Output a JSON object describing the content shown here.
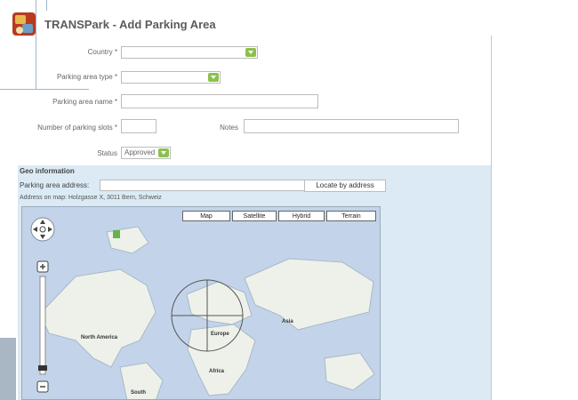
{
  "app": {
    "title": "TRANSPark - Add Parking Area"
  },
  "form": {
    "country_label": "Country *",
    "parking_type_label": "Parking area type *",
    "parking_name_label": "Parking area name *",
    "parking_slots_label": "Number of parking slots *",
    "notes_label": "Notes",
    "status_label": "Status",
    "status_value": "Approved"
  },
  "geo": {
    "title": "Geo information",
    "address_label": "Parking area address:",
    "locate_button": "Locate by address",
    "address_on_map": "Address on map: Holzgasse X, 3011 Bern, Schweiz"
  },
  "map": {
    "types": [
      "Map",
      "Satellite",
      "Hybrid",
      "Terrain"
    ],
    "labels": [
      "North America",
      "Europe",
      "Asia",
      "Africa",
      "South"
    ]
  },
  "colors": {
    "accent": "#8cc04f",
    "geo_bg": "#dbeaf4",
    "water": "#c3d4ea",
    "land": "#eef1ea"
  }
}
